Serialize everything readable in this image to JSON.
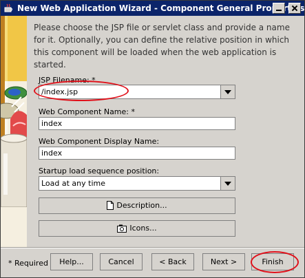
{
  "window": {
    "title": "New Web Application Wizard - Component General Properties"
  },
  "intro_text": "Please choose the JSP file or servlet class and provide a name for it. Optionally, you can define the relative position in which this component will be loaded when the web application is started.",
  "form": {
    "jsp_filename": {
      "label": "JSP Filename: *",
      "value": "/index.jsp"
    },
    "component_name": {
      "label": "Web Component Name: *",
      "value": "index"
    },
    "display_name": {
      "label": "Web Component Display Name:",
      "value": "index"
    },
    "startup": {
      "label": "Startup load sequence position:",
      "value": "Load at any time"
    }
  },
  "buttons": {
    "description": "Description...",
    "icons": "Icons...",
    "help": "Help...",
    "cancel": "Cancel",
    "back": "< Back",
    "next": "Next >",
    "finish": "Finish"
  },
  "required_note": "* Required",
  "colors": {
    "titlebar": "#0b246a",
    "highlight_ring": "#e0101a",
    "panel": "#d6d3ce"
  }
}
